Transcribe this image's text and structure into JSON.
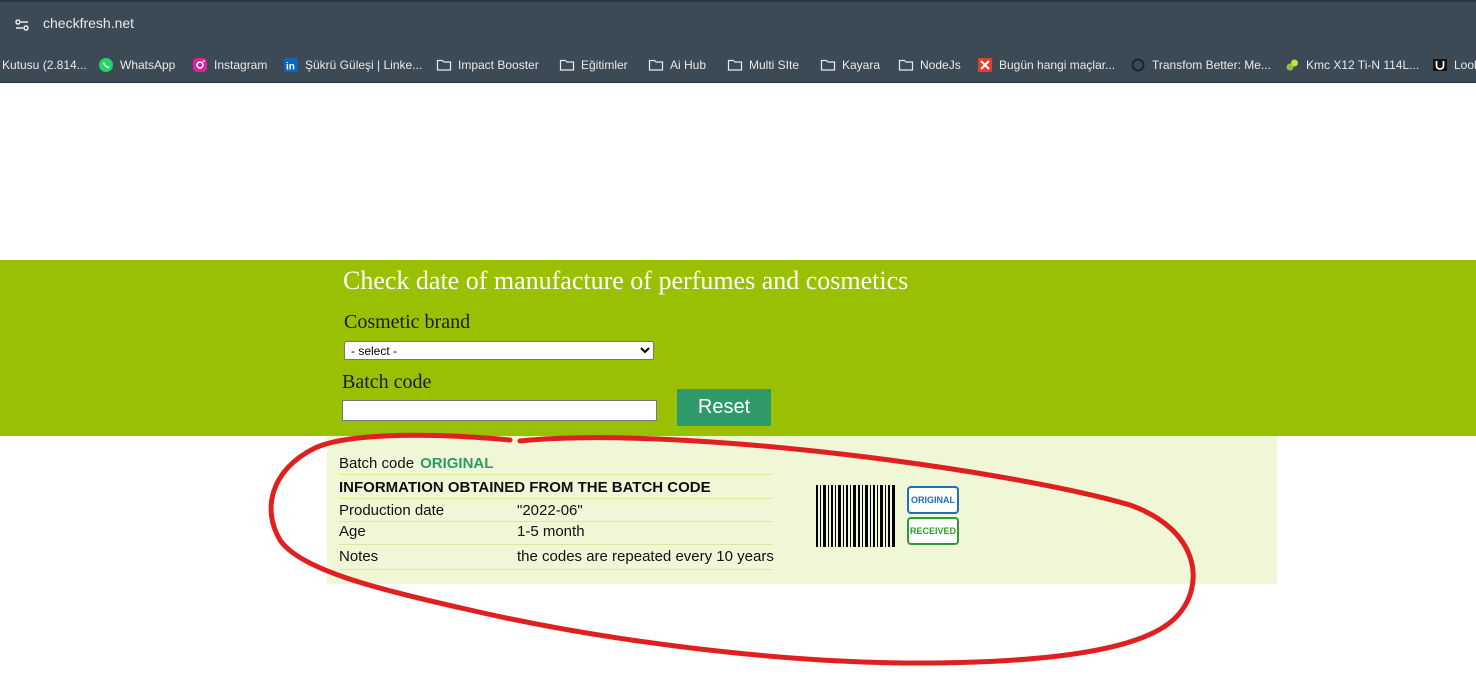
{
  "browser": {
    "url": "checkfresh.net",
    "bookmarks": [
      {
        "label": "Kutusu (2.814...",
        "icon": "mail-icon"
      },
      {
        "label": "WhatsApp",
        "icon": "whatsapp-icon"
      },
      {
        "label": "Instagram",
        "icon": "instagram-icon"
      },
      {
        "label": "Şükrü Güleşi | Linke...",
        "icon": "linkedin-icon"
      },
      {
        "label": "Impact Booster",
        "icon": "folder-icon"
      },
      {
        "label": "Eğitimler",
        "icon": "folder-icon"
      },
      {
        "label": "Ai Hub",
        "icon": "folder-icon"
      },
      {
        "label": "Multi SIte",
        "icon": "folder-icon"
      },
      {
        "label": "Kayara",
        "icon": "folder-icon"
      },
      {
        "label": "NodeJs",
        "icon": "folder-icon"
      },
      {
        "label": "Bugün hangi maçlar...",
        "icon": "sports-site-icon"
      },
      {
        "label": "Transfom Better: Me...",
        "icon": "circle-site-icon"
      },
      {
        "label": "Kmc X12 Ti-N 114L...",
        "icon": "product-site-icon"
      },
      {
        "label": "Look",
        "icon": "u-site-icon"
      }
    ]
  },
  "page": {
    "title": "Check date of manufacture of perfumes and cosmetics",
    "brand_label": "Cosmetic brand",
    "brand_select_value": "- select -",
    "batch_label": "Batch code",
    "batch_value": "",
    "reset_label": "Reset"
  },
  "result": {
    "batch_label": "Batch code",
    "status": "ORIGINAL",
    "info_heading": "INFORMATION OBTAINED FROM THE BATCH CODE",
    "rows": [
      {
        "key": "Production date",
        "value": "\"2022-06\""
      },
      {
        "key": "Age",
        "value": "1-5 month"
      },
      {
        "key": "Notes",
        "value": "the codes are repeated every 10 years"
      }
    ],
    "stamp_original": "ORIGINAL",
    "stamp_received": "RECEIVED"
  },
  "colors": {
    "hero_bg": "#99c002",
    "result_bg": "#f0f7d7",
    "accent_green": "#2e9a6a",
    "annotation_red": "#e02020"
  }
}
